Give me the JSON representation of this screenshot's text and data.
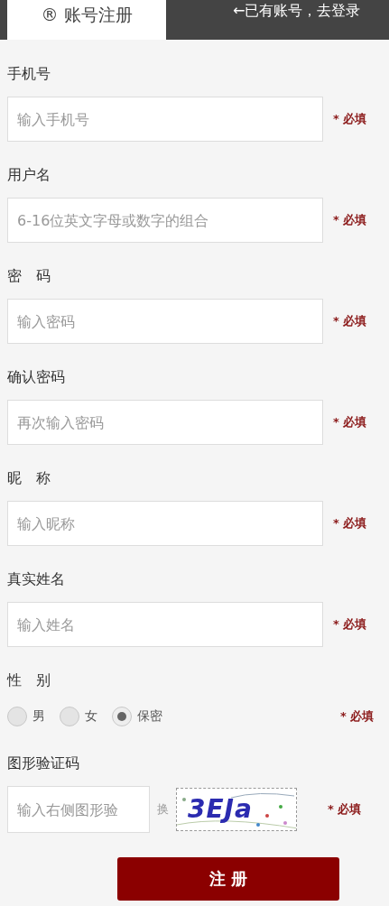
{
  "header": {
    "tab": {
      "icon": "®",
      "label": "账号注册",
      "selected": true
    },
    "login_link": "←已有账号，去登录"
  },
  "fields": [
    {
      "kind": "text",
      "label": "手机号",
      "placeholder": "输入手机号",
      "required": "* 必填"
    },
    {
      "kind": "text",
      "label": "用户名",
      "placeholder": "6-16位英文字母或数字的组合",
      "required": "* 必填"
    },
    {
      "kind": "text",
      "label": "密　码",
      "placeholder": "输入密码",
      "required": "* 必填"
    },
    {
      "kind": "text",
      "label": "确认密码",
      "placeholder": "再次输入密码",
      "required": "* 必填"
    },
    {
      "kind": "text",
      "label": "昵　称",
      "placeholder": "输入昵称",
      "required": "* 必填"
    },
    {
      "kind": "text",
      "label": "真实姓名",
      "placeholder": "输入姓名",
      "required": "* 必填"
    },
    {
      "kind": "radio",
      "label": "性　别",
      "options": [
        {
          "label": "男",
          "selected": false
        },
        {
          "label": "女",
          "selected": false
        },
        {
          "label": "保密",
          "selected": true
        }
      ],
      "required": "* 必填"
    },
    {
      "kind": "captcha",
      "label": "图形验证码",
      "placeholder": "输入右侧图形验",
      "refresh": "换",
      "captcha_text": "3EJa",
      "required": "* 必填"
    }
  ],
  "submit": "注 册"
}
